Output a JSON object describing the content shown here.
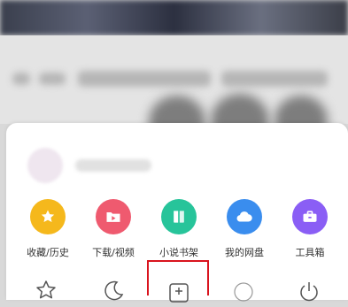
{
  "menu": {
    "items": [
      {
        "label": "收藏/历史",
        "icon": "star-icon",
        "color": "#f5b81c"
      },
      {
        "label": "下载/视频",
        "icon": "download-folder-icon",
        "color": "#ef5a6f"
      },
      {
        "label": "小说书架",
        "icon": "book-icon",
        "color": "#27c49a"
      },
      {
        "label": "我的网盘",
        "icon": "cloud-icon",
        "color": "#3a8dee"
      },
      {
        "label": "工具箱",
        "icon": "toolbox-icon",
        "color": "#8a5ef5"
      }
    ],
    "second_row_icons": [
      "star-outline-icon",
      "moon-icon",
      "add-bookmark-icon",
      "circle-icon",
      "power-icon"
    ]
  },
  "highlight_color": "#d9141e"
}
